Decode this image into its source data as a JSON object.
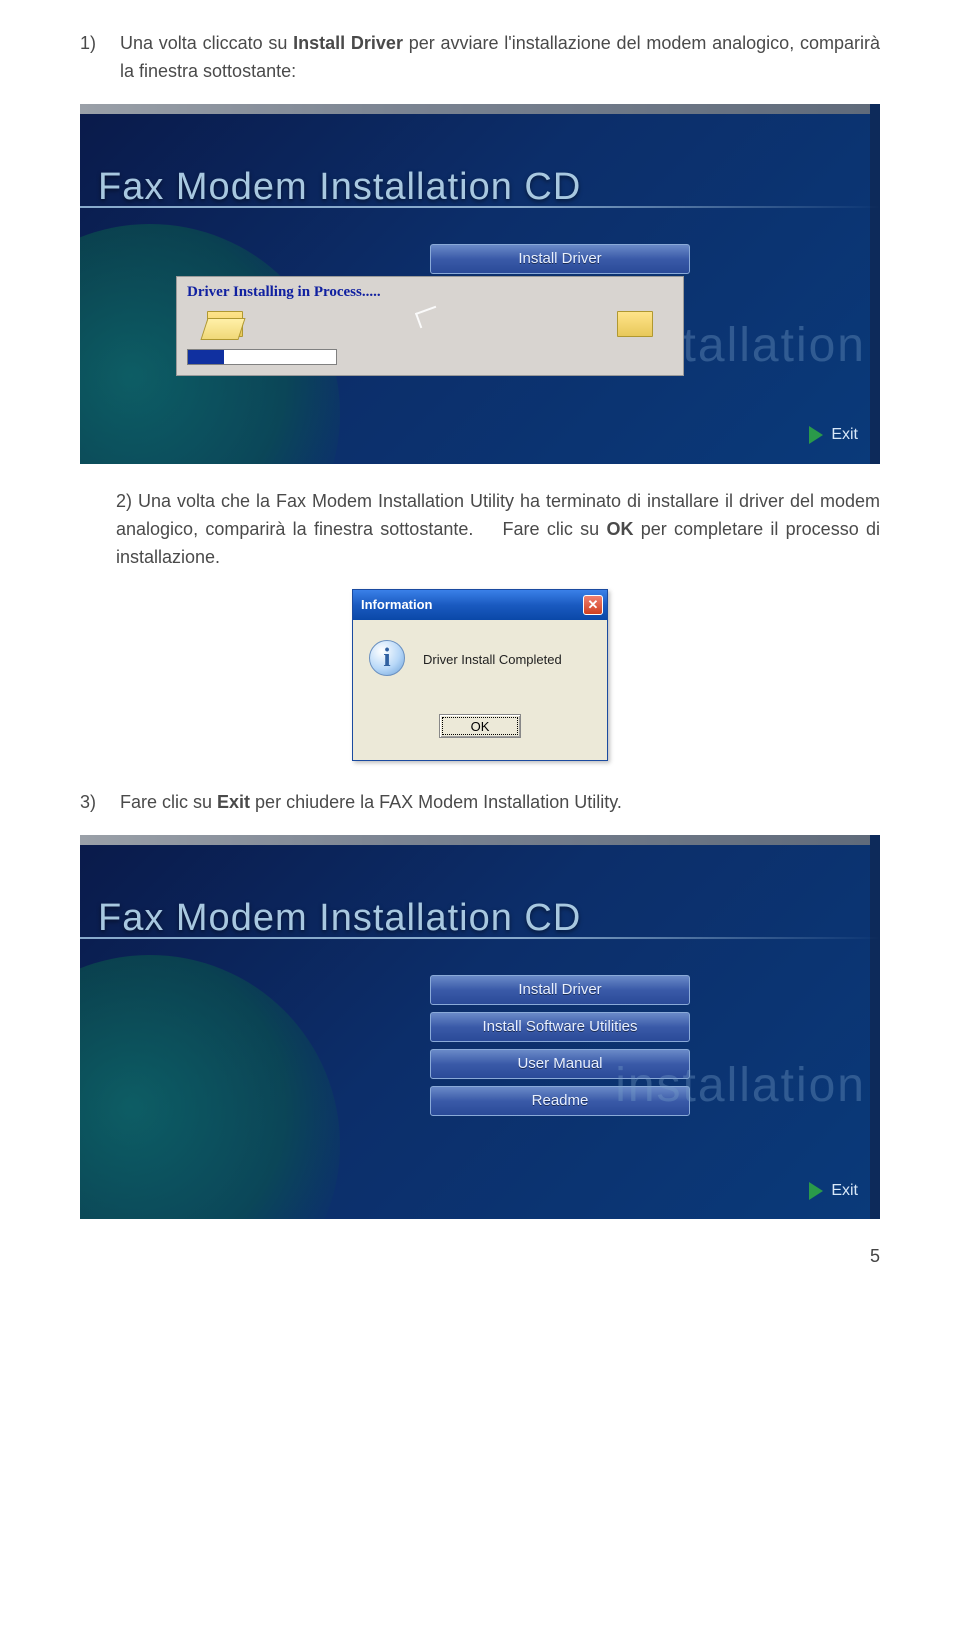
{
  "para1": {
    "num": "1)",
    "t1": "Una volta cliccato su ",
    "bold": "Install Driver",
    "t2": " per avviare l'installazione del modem analogico, comparirà la finestra sottostante:"
  },
  "panel1": {
    "title": "Fax Modem Installation CD",
    "button_install_driver": "Install Driver",
    "progress_title": "Driver Installing in Process.....",
    "bg_word": "installation",
    "exit_label": "Exit"
  },
  "para2": {
    "t1": "2) Una volta che la Fax Modem Installation Utility ha terminato di installare il driver del modem analogico, comparirà la finestra sottostante.",
    "t2_a": "Fare clic su ",
    "t2_bold": "OK",
    "t2_b": " per completare il processo di installazione."
  },
  "info": {
    "title": "Information",
    "icon_letter": "i",
    "message": "Driver Install Completed",
    "ok_label": "OK"
  },
  "para3": {
    "num": "3)",
    "t1": "Fare clic su ",
    "bold": "Exit",
    "t2": " per chiudere la FAX Modem Installation Utility."
  },
  "panel3": {
    "title": "Fax Modem Installation CD",
    "buttons": {
      "install_driver": "Install Driver",
      "install_utils": "Install Software Utilities",
      "user_manual": "User Manual",
      "readme": "Readme"
    },
    "bg_word": "installation",
    "exit_label": "Exit"
  },
  "page_number": "5"
}
